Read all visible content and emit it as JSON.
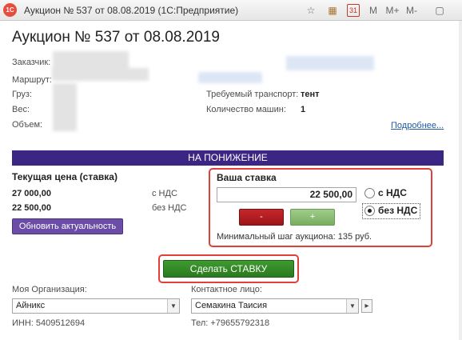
{
  "window": {
    "logo": "1C",
    "title": "Аукцион № 537 от 08.08.2019  (1С:Предприятие)",
    "toolbar": {
      "star_icon": "☆",
      "calc_icon": "▦",
      "calendar_icon": "31",
      "m": "M",
      "m_plus": "M+",
      "m_minus": "M-",
      "minimize_icon": "▢"
    }
  },
  "header": {
    "title": "Аукцион № 537 от 08.08.2019"
  },
  "info": {
    "customer_label": "Заказчик:",
    "route_label": "Маршрут:",
    "cargo_label": "Груз:",
    "weight_label": "Вес:",
    "volume_label": "Объем:",
    "transport_label": "Требуемый транспорт:",
    "transport_value": "тент",
    "trucks_label": "Количество машин:",
    "trucks_value": "1",
    "more_link": "Подробнее..."
  },
  "banner": "НА ПОНИЖЕНИЕ",
  "current_price": {
    "header": "Текущая цена (ставка)",
    "with_vat_value": "27 000,00",
    "with_vat_label": "с НДС",
    "without_vat_value": "22 500,00",
    "without_vat_label": "без НДС",
    "refresh_button": "Обновить актуальность"
  },
  "bid": {
    "title": "Ваша ставка",
    "value": "22 500,00",
    "minus_label": "-",
    "plus_label": "+",
    "radio_with_vat": "с НДС",
    "radio_without_vat": "без НДС",
    "selected": "без НДС",
    "min_step": "Минимальный шаг аукциона: 135 руб."
  },
  "make_bid_button": "Сделать СТАВКУ",
  "organization": {
    "label": "Моя Организация:",
    "value": "Айникс",
    "inn": "ИНН: 5409512694"
  },
  "contact": {
    "label": "Контактное лицо:",
    "value": "Семакина Таисия",
    "phone": "Тел: +79655792318"
  },
  "colors": {
    "banner": "#3b2683",
    "refresh_button": "#6b4da8",
    "minus_button": "#b41f24",
    "plus_button": "#8cbf76",
    "make_bid_button": "#2f8a24",
    "highlight": "#e0403a",
    "link": "#1f5aa6"
  }
}
